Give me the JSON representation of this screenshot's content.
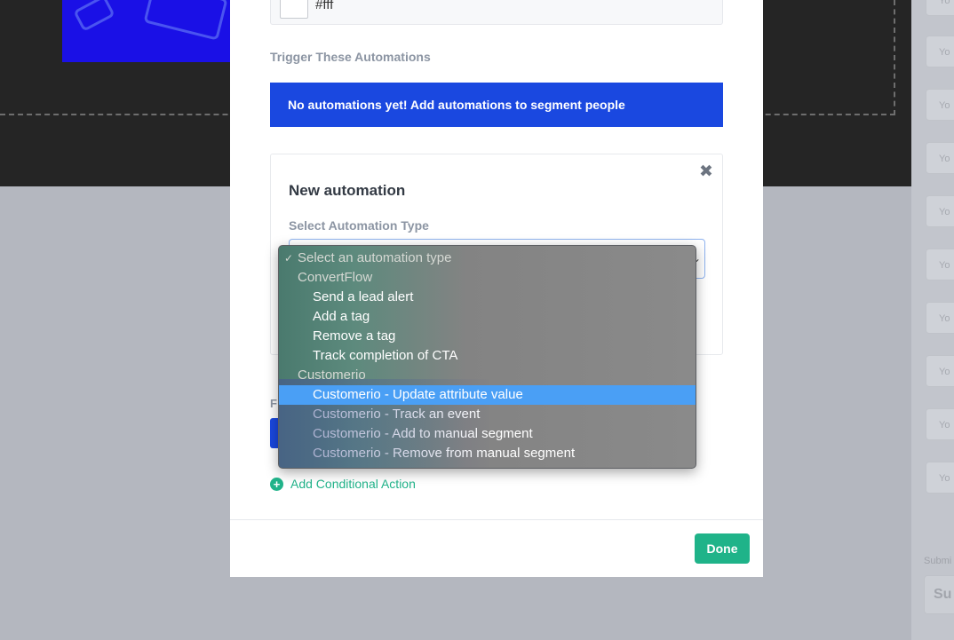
{
  "modal": {
    "color_value": "#fff",
    "trigger_label": "Trigger These Automations",
    "empty_notice": "No automations yet! Add automations to segment people",
    "card": {
      "close_glyph": "✖",
      "title": "New automation",
      "type_label": "Select Automation Type"
    },
    "f_label": "F",
    "add_conditional": "Add Conditional Action",
    "done_label": "Done"
  },
  "dropdown": {
    "check_glyph": "✓",
    "placeholder": "Select an automation type",
    "groups": [
      {
        "label": "ConvertFlow",
        "options": [
          "Send a lead alert",
          "Add a tag",
          "Remove a tag",
          "Track completion of CTA"
        ]
      },
      {
        "label": "Customerio",
        "options": [
          "Customerio - Update attribute value",
          "Customerio - Track an event",
          "Customerio - Add to manual segment",
          "Customerio - Remove from manual segment"
        ]
      }
    ],
    "selected": "Customerio - Update attribute value"
  },
  "background": {
    "right_item_text": "Yo",
    "right_label": "Submi",
    "right_input_text": "Su"
  },
  "colors": {
    "primary_blue": "#1a48e0",
    "success_green": "#1fb389",
    "highlight": "#4a9ff5"
  }
}
